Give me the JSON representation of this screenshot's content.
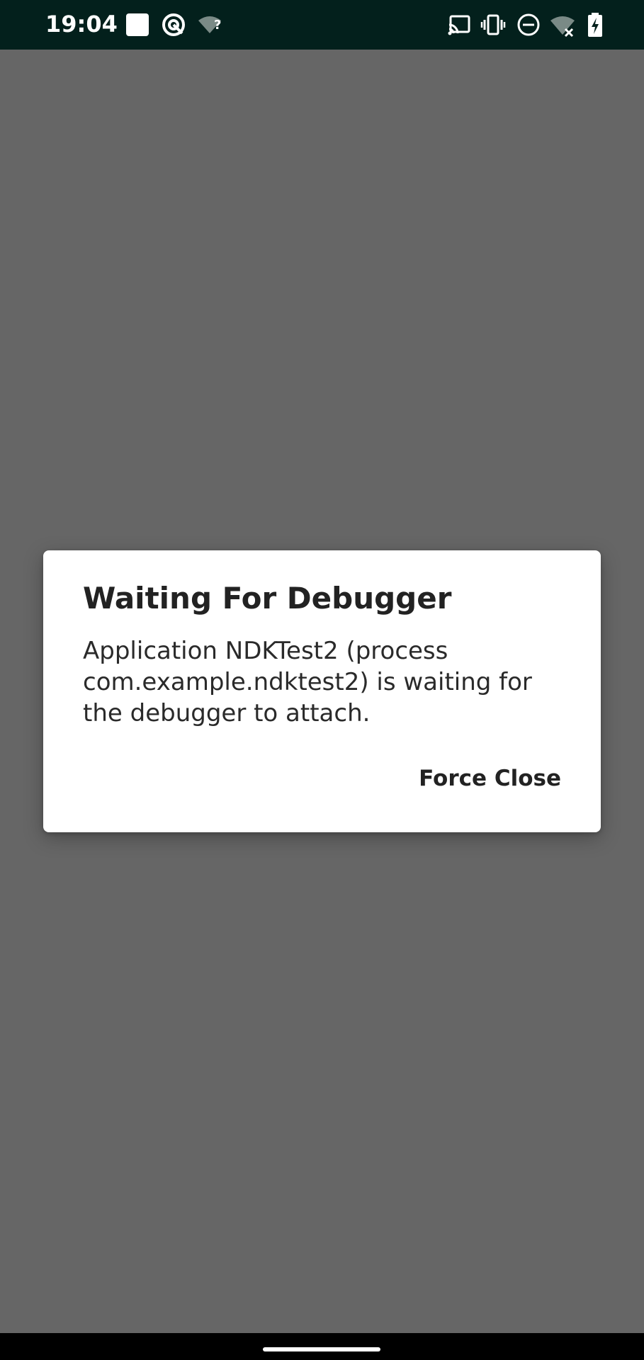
{
  "status_bar": {
    "time": "19:04",
    "wifi_question_mark": "?",
    "left_icons": [
      "app-square-icon",
      "data-saver-icon",
      "wifi-unknown-icon"
    ],
    "right_icons": [
      "cast-icon",
      "vibrate-icon",
      "do-not-disturb-icon",
      "wifi-off-icon",
      "battery-charging-icon"
    ]
  },
  "dialog": {
    "title": "Waiting For Debugger",
    "message": "Application NDKTest2 (process com.example.ndktest2) is waiting for the debugger to attach.",
    "force_close_label": "Force Close"
  },
  "colors": {
    "background_scrim": "#666666",
    "status_bar": "#03201c",
    "dialog_background": "#ffffff",
    "nav_bar": "#000000"
  }
}
